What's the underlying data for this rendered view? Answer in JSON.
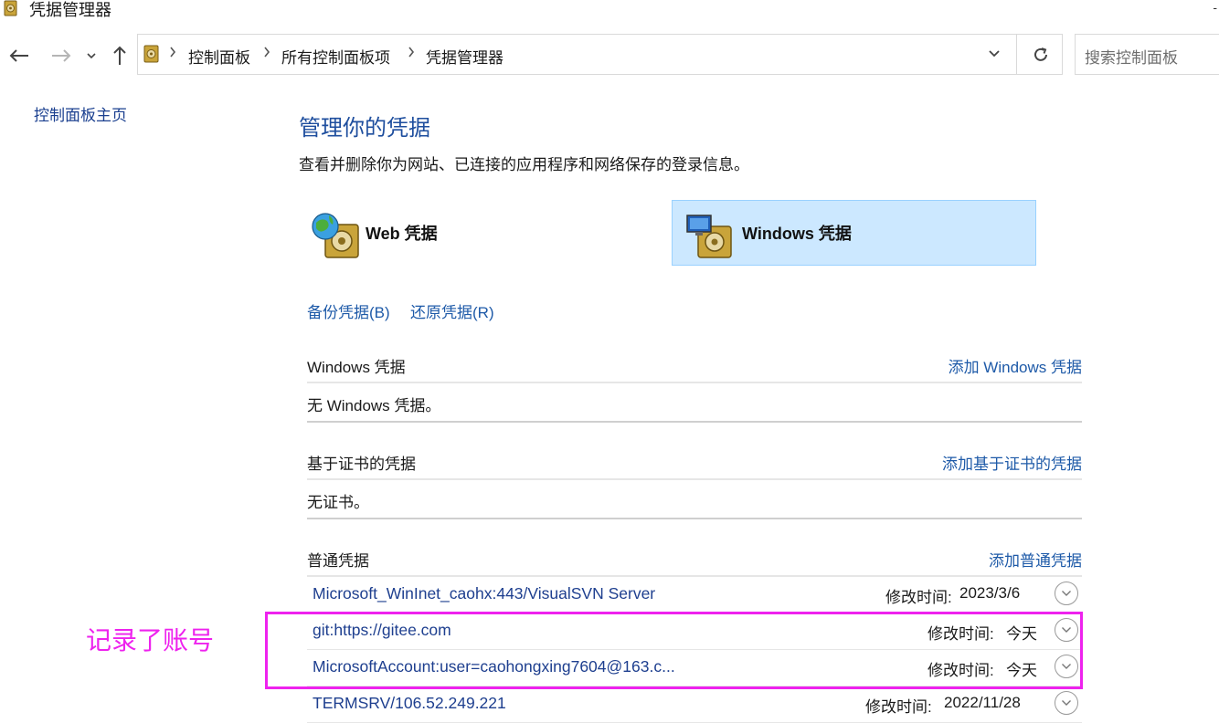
{
  "window": {
    "title": "凭据管理器",
    "minimize_glyph": "-"
  },
  "nav": {
    "back_icon": "back-arrow-icon",
    "forward_icon": "forward-arrow-icon",
    "recent_icon": "chevron-down-icon",
    "up_icon": "up-arrow-icon",
    "breadcrumbs": [
      "控制面板",
      "所有控制面板项",
      "凭据管理器"
    ],
    "search_placeholder": "搜索控制面板"
  },
  "sidebar": {
    "home_link": "控制面板主页"
  },
  "main": {
    "title": "管理你的凭据",
    "description": "查看并删除你为网站、已连接的应用程序和网络保存的登录信息。",
    "tabs": [
      {
        "label": "Web 凭据",
        "icon": "web-credential-safe-icon",
        "selected": false
      },
      {
        "label": "Windows 凭据",
        "icon": "windows-credential-safe-icon",
        "selected": true
      }
    ],
    "backup_link": "备份凭据(B)",
    "restore_link": "还原凭据(R)",
    "windows_section": {
      "title": "Windows 凭据",
      "add_link": "添加 Windows 凭据",
      "empty_text": "无 Windows 凭据。"
    },
    "cert_section": {
      "title": "基于证书的凭据",
      "add_link": "添加基于证书的凭据",
      "empty_text": "无证书。"
    },
    "generic_section": {
      "title": "普通凭据",
      "add_link": "添加普通凭据",
      "modified_label": "修改时间:",
      "items": [
        {
          "name": "Microsoft_WinInet_caohx:443/VisualSVN Server",
          "modified": "2023/3/6"
        },
        {
          "name": "git:https://gitee.com",
          "modified": "今天"
        },
        {
          "name": "MicrosoftAccount:user=caohongxing7604@163.c...",
          "modified": "今天"
        },
        {
          "name": "TERMSRV/106.52.249.221",
          "modified": "2022/11/28"
        }
      ]
    }
  },
  "annotation": {
    "text": "记录了账号",
    "color": "#ee22ee"
  },
  "colors": {
    "link": "#1e5aa8",
    "title": "#1e4e9e",
    "selected_tab": "#cce8ff"
  }
}
